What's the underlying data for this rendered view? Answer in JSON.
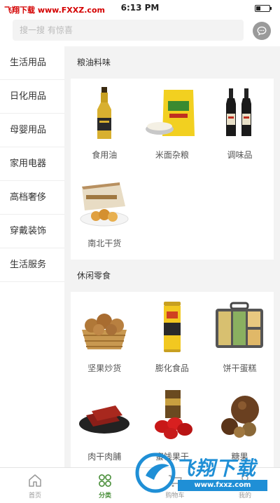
{
  "status_bar": {
    "watermark": "飞翔下载 www.FXXZ.com",
    "time": "6:13 PM",
    "battery_level": 0.35
  },
  "search": {
    "placeholder": "搜一搜 有惊喜"
  },
  "sidebar": {
    "items": [
      {
        "label": "生活用品"
      },
      {
        "label": "日化用品"
      },
      {
        "label": "母婴用品"
      },
      {
        "label": "家用电器"
      },
      {
        "label": "高档奢侈"
      },
      {
        "label": "穿戴装饰"
      },
      {
        "label": "生活服务"
      }
    ]
  },
  "sections": [
    {
      "title": "粮油料味",
      "items": [
        {
          "label": "食用油",
          "icon": "oil-bottle-icon"
        },
        {
          "label": "米面杂粮",
          "icon": "rice-bag-icon"
        },
        {
          "label": "调味品",
          "icon": "sauce-bottles-icon"
        },
        {
          "label": "南北干货",
          "icon": "dried-goods-icon"
        }
      ]
    },
    {
      "title": "休闲零食",
      "items": [
        {
          "label": "坚果炒货",
          "icon": "walnut-basket-icon"
        },
        {
          "label": "膨化食品",
          "icon": "snack-can-icon"
        },
        {
          "label": "饼干蛋糕",
          "icon": "biscuit-box-icon"
        },
        {
          "label": "肉干肉脯",
          "icon": "jerky-icon"
        },
        {
          "label": "蜜饯果干",
          "icon": "dates-icon"
        },
        {
          "label": "糖果",
          "icon": "chocolate-icon"
        }
      ]
    }
  ],
  "tabbar": {
    "tabs": [
      {
        "label": "首页",
        "icon": "home-icon"
      },
      {
        "label": "分类",
        "icon": "category-icon"
      },
      {
        "label": "购物车",
        "icon": "cart-icon"
      },
      {
        "label": "我的",
        "icon": "user-icon"
      }
    ],
    "active_index": 1
  },
  "watermark_br": {
    "text": "飞翔下载",
    "url": "www.fxxz.com"
  },
  "colors": {
    "accent": "#4a8f3a",
    "background": "#f3f3f3",
    "watermark_red": "#d40000",
    "watermark_blue": "#1f8fd6"
  }
}
